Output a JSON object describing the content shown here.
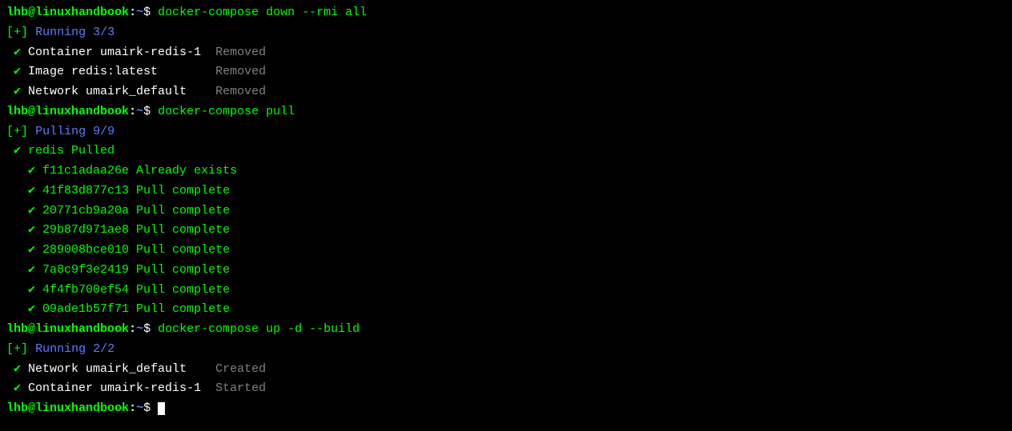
{
  "prompt": {
    "user": "lhb",
    "at": "@",
    "host": "linuxhandbook",
    "colon": ":",
    "path": "~",
    "dollar": "$"
  },
  "cmd1": "docker-compose down --rmi all",
  "run1": {
    "bracket_open": "[",
    "plus": "+",
    "bracket_close": "]",
    "label": "Running",
    "count": "3/3"
  },
  "down_items": [
    {
      "check": "✔",
      "resource": "Container umairk-redis-1",
      "status": "Removed"
    },
    {
      "check": "✔",
      "resource": "Image redis:latest",
      "status": "Removed"
    },
    {
      "check": "✔",
      "resource": "Network umairk_default",
      "status": "Removed"
    }
  ],
  "cmd2": "docker-compose pull",
  "pull_header": {
    "bracket_open": "[",
    "plus": "+",
    "bracket_close": "]",
    "label": "Pulling",
    "count": "9/9"
  },
  "pull_root": {
    "check": "✔",
    "text": "redis Pulled"
  },
  "layers": [
    {
      "check": "✔",
      "hash": "f11c1adaa26e",
      "status": "Already exists"
    },
    {
      "check": "✔",
      "hash": "41f83d877c13",
      "status": "Pull complete"
    },
    {
      "check": "✔",
      "hash": "20771cb9a20a",
      "status": "Pull complete"
    },
    {
      "check": "✔",
      "hash": "29b87d971ae8",
      "status": "Pull complete"
    },
    {
      "check": "✔",
      "hash": "289008bce010",
      "status": "Pull complete"
    },
    {
      "check": "✔",
      "hash": "7a8c9f3e2419",
      "status": "Pull complete"
    },
    {
      "check": "✔",
      "hash": "4f4fb700ef54",
      "status": "Pull complete"
    },
    {
      "check": "✔",
      "hash": "09ade1b57f71",
      "status": "Pull complete"
    }
  ],
  "cmd3": "docker-compose up -d --build",
  "run2": {
    "bracket_open": "[",
    "plus": "+",
    "bracket_close": "]",
    "label": "Running",
    "count": "2/2"
  },
  "up_items": [
    {
      "check": "✔",
      "resource": "Network umairk_default",
      "status": "Created"
    },
    {
      "check": "✔",
      "resource": "Container umairk-redis-1",
      "status": "Started"
    }
  ]
}
